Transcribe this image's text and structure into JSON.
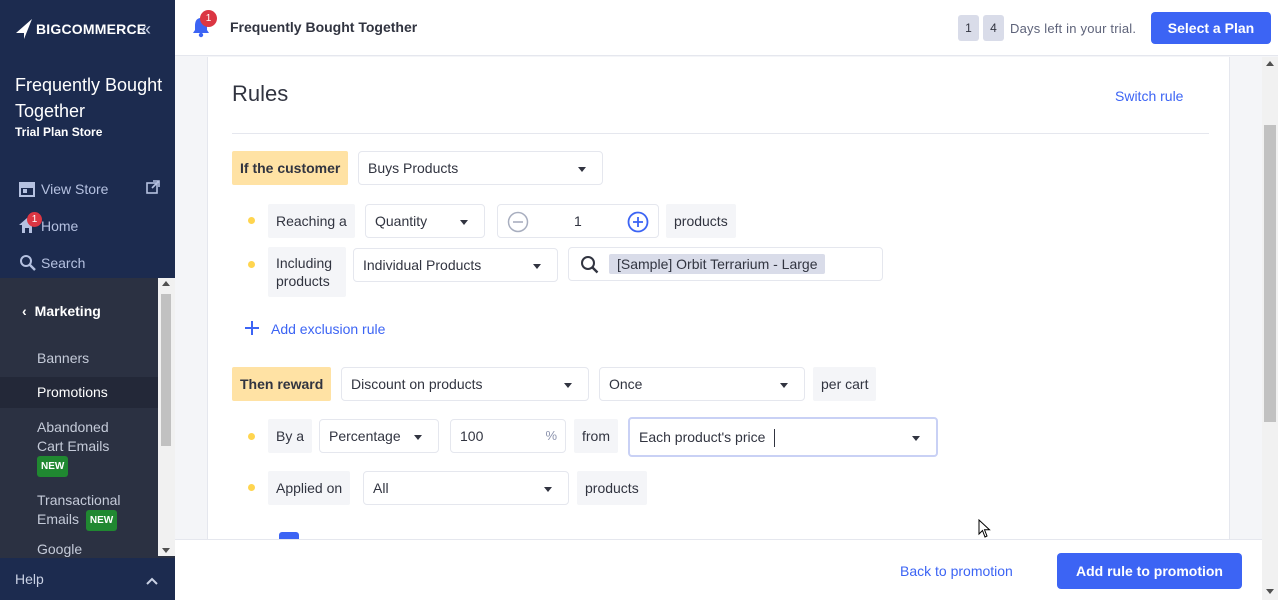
{
  "sidebar": {
    "brand": "BIGCOMMERCE",
    "app_title": "Frequently Bought Together",
    "app_subtitle": "Trial Plan Store",
    "nav": [
      {
        "label": "View Store",
        "icon": "storefront-icon"
      },
      {
        "label": "Home",
        "icon": "home-icon",
        "badge": "1"
      },
      {
        "label": "Search",
        "icon": "search-icon"
      }
    ],
    "section": "Marketing",
    "items": [
      {
        "label": "Banners"
      },
      {
        "label": "Promotions"
      },
      {
        "label": "Abandoned Cart Emails",
        "badge": "NEW"
      },
      {
        "label": "Transactional Emails",
        "badge": "NEW"
      },
      {
        "label": "Google"
      }
    ],
    "help": "Help"
  },
  "topbar": {
    "bell_badge": "1",
    "title": "Frequently Bought Together",
    "trial_digits": [
      "1",
      "4"
    ],
    "trial_text": "Days left in your trial.",
    "select_plan": "Select a Plan"
  },
  "rules": {
    "heading": "Rules",
    "switch_rule": "Switch rule",
    "if_customer": "If the customer",
    "condition_select": "Buys Products",
    "reaching_label": "Reaching a",
    "reaching_select": "Quantity",
    "quantity_value": "1",
    "products_label": "products",
    "including_label": "Including products",
    "including_select": "Individual Products",
    "selected_product": "[Sample] Orbit Terrarium - Large",
    "add_exclusion": "Add exclusion rule",
    "then_reward": "Then reward",
    "reward_select": "Discount on products",
    "frequency_select": "Once",
    "per_cart": "per cart",
    "by_label": "By a",
    "by_select": "Percentage",
    "amount_value": "100",
    "percent_symbol": "%",
    "from_label": "from",
    "from_select": "Each product's price",
    "applied_label": "Applied on",
    "applied_select": "All",
    "applied_products_label": "products"
  },
  "footer": {
    "back": "Back to promotion",
    "add": "Add rule to promotion"
  },
  "colors": {
    "sidebar": "#1c2b4f",
    "submenu": "#2b3142",
    "accent": "#3c64f4",
    "tag": "#ffe2a4",
    "bullet": "#ffd54f",
    "badge_new": "#208831",
    "badge_red": "#db3643"
  }
}
